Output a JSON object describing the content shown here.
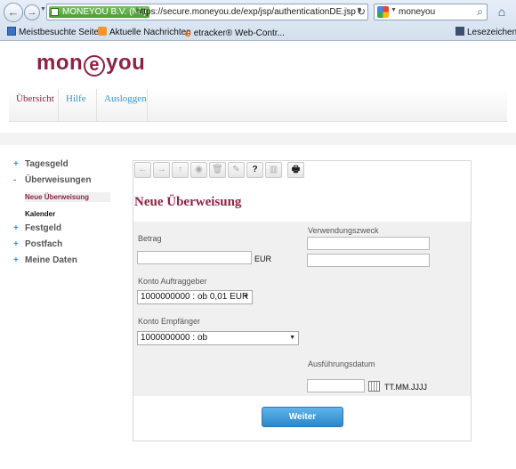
{
  "browser": {
    "identity": "MONEYOU B.V. (NL)",
    "url": "https://secure.moneyou.de/exp/jsp/authenticationDE.jsp",
    "search_value": "moneyou",
    "bookmarks": [
      "Meistbesuchte Seiten",
      "Aktuelle Nachrichten",
      "etracker® Web-Contr...",
      "Lesezeichen"
    ]
  },
  "logo": {
    "pre": "mon",
    "ring": "e",
    "post": "you"
  },
  "topnav": [
    "Übersicht",
    "Hilfe",
    "Ausloggen"
  ],
  "sidebar": {
    "items": [
      {
        "sym": "+",
        "label": "Tagesgeld"
      },
      {
        "sym": "-",
        "label": "Überweisungen"
      },
      {
        "sym": "+",
        "label": "Festgeld"
      },
      {
        "sym": "+",
        "label": "Postfach"
      },
      {
        "sym": "+",
        "label": "Meine Daten"
      }
    ],
    "subitems": [
      "Neue Überweisung",
      "Kalender"
    ]
  },
  "toolbar": {
    "icons": [
      "arrow-left-icon",
      "arrow-right-icon",
      "arrow-up-icon",
      "eye-icon",
      "trash-icon",
      "edit-icon",
      "help-icon",
      "chart-icon",
      "print-icon"
    ],
    "glyphs": [
      "←",
      "→",
      "↑",
      "◉",
      "🗑",
      "✎",
      "?",
      "▥",
      "🖶"
    ]
  },
  "form": {
    "title": "Neue Überweisung",
    "betrag_label": "Betrag",
    "betrag_unit": "EUR",
    "verwendungszweck_label": "Verwendungszweck",
    "konto_auftraggeber_label": "Konto Auftraggeber",
    "konto_auftraggeber_value": "1000000000 : ob 0,01 EUR",
    "konto_empfaenger_label": "Konto Empfänger",
    "konto_empfaenger_value": "1000000000 : ob",
    "ausfuehrungsdatum_label": "Ausführungsdatum",
    "date_format": "TT.MM.JJJJ",
    "submit_label": "Weiter"
  },
  "colors": {
    "brand": "#8d2244",
    "link": "#3399cc",
    "button": "#2b86c9"
  }
}
